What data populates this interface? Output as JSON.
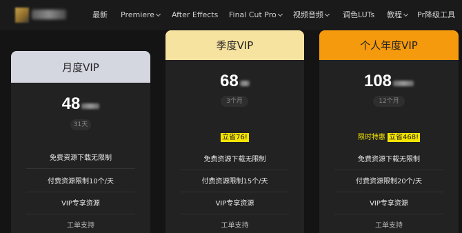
{
  "nav": {
    "items": [
      {
        "label": "最新",
        "dropdown": false
      },
      {
        "label": "Premiere",
        "dropdown": true
      },
      {
        "label": "After Effects",
        "dropdown": false
      },
      {
        "label": "Final Cut Pro",
        "dropdown": true
      },
      {
        "label": "视频音频",
        "dropdown": true
      },
      {
        "label": "调色LUTs",
        "dropdown": false
      },
      {
        "label": "教程",
        "dropdown": true
      },
      {
        "label": "Pr降级工具",
        "dropdown": false
      }
    ]
  },
  "plans": [
    {
      "title": "月度VIP",
      "price": "48",
      "duration": "31天",
      "promo_plain": "",
      "promo_highlight": "",
      "features": [
        "免费资源下载无限制",
        "付费资源限制10个/天",
        "VIP专享资源",
        "工单支持"
      ]
    },
    {
      "title": "季度VIP",
      "price": "68",
      "duration": "3个月",
      "promo_plain": "",
      "promo_highlight": "立省76!",
      "features": [
        "免费资源下载无限制",
        "付费资源限制15个/天",
        "VIP专享资源",
        "工单支持"
      ]
    },
    {
      "title": "个人年度VIP",
      "price": "108",
      "duration": "12个月",
      "promo_plain": "限时特惠",
      "promo_highlight": "立省468!",
      "features": [
        "免费资源下载无限制",
        "付费资源限制20个/天",
        "VIP专享资源",
        "工单支持"
      ]
    }
  ],
  "colors": {
    "monthly_header": "#d4d6e0",
    "quarterly_header": "#f7e3a0",
    "yearly_header": "#f59a0c",
    "highlight": "#f5e400"
  }
}
